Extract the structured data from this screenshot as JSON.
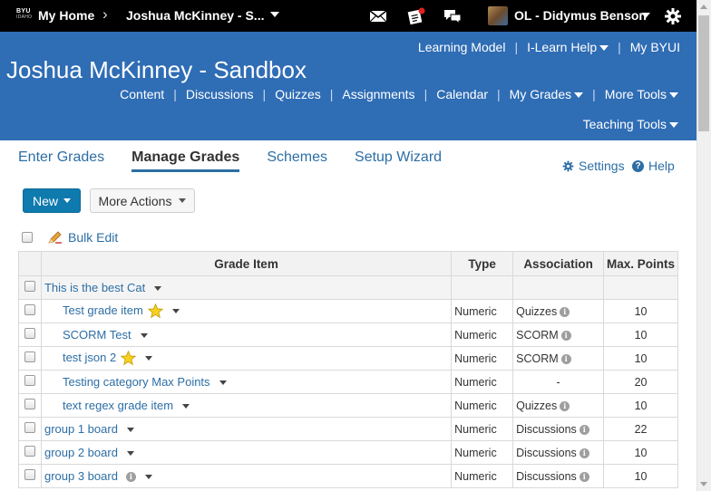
{
  "topbar": {
    "logo_main": "BYU",
    "logo_sub": "IDAHO",
    "home_label": "My Home",
    "course_label": "Joshua McKinney - S...",
    "icons": [
      "email-icon",
      "updates-icon",
      "chat-icon"
    ],
    "user_name": "OL - Didymus Benson"
  },
  "header": {
    "util_links": [
      "Learning Model",
      "I-Learn Help",
      "My BYUI"
    ],
    "course_title": "Joshua McKinney - Sandbox",
    "nav": [
      "Content",
      "Discussions",
      "Quizzes",
      "Assignments",
      "Calendar",
      "My Grades",
      "More Tools"
    ],
    "nav_second": "Teaching Tools"
  },
  "tabs": [
    "Enter Grades",
    "Manage Grades",
    "Schemes",
    "Setup Wizard"
  ],
  "settings_label": "Settings",
  "help_label": "Help",
  "buttons": {
    "new": "New",
    "more_actions": "More Actions"
  },
  "bulk_edit_label": "Bulk Edit",
  "table": {
    "headers": [
      "Grade Item",
      "Type",
      "Association",
      "Max. Points"
    ],
    "rows": [
      {
        "name": "This is the best Cat",
        "type": "",
        "assoc": "",
        "max": "",
        "category": true
      },
      {
        "name": "Test grade item",
        "type": "Numeric",
        "assoc": "Quizzes",
        "max": "10",
        "star": true
      },
      {
        "name": "SCORM Test",
        "type": "Numeric",
        "assoc": "SCORM",
        "max": "10"
      },
      {
        "name": "test json 2",
        "type": "Numeric",
        "assoc": "SCORM",
        "max": "10",
        "star": true
      },
      {
        "name": "Testing category Max Points",
        "type": "Numeric",
        "assoc": "-",
        "max": "20"
      },
      {
        "name": "text regex grade item",
        "type": "Numeric",
        "assoc": "Quizzes",
        "max": "10"
      },
      {
        "name": "group 1 board",
        "type": "Numeric",
        "assoc": "Discussions",
        "max": "22"
      },
      {
        "name": "group 2 board",
        "type": "Numeric",
        "assoc": "Discussions",
        "max": "10"
      },
      {
        "name": "group 3 board",
        "type": "Numeric",
        "assoc": "Discussions",
        "max": "10"
      }
    ]
  },
  "colors": {
    "header_blue": "#2f6db5",
    "link_blue": "#2c6ea5",
    "new_button": "#0f7aad"
  }
}
